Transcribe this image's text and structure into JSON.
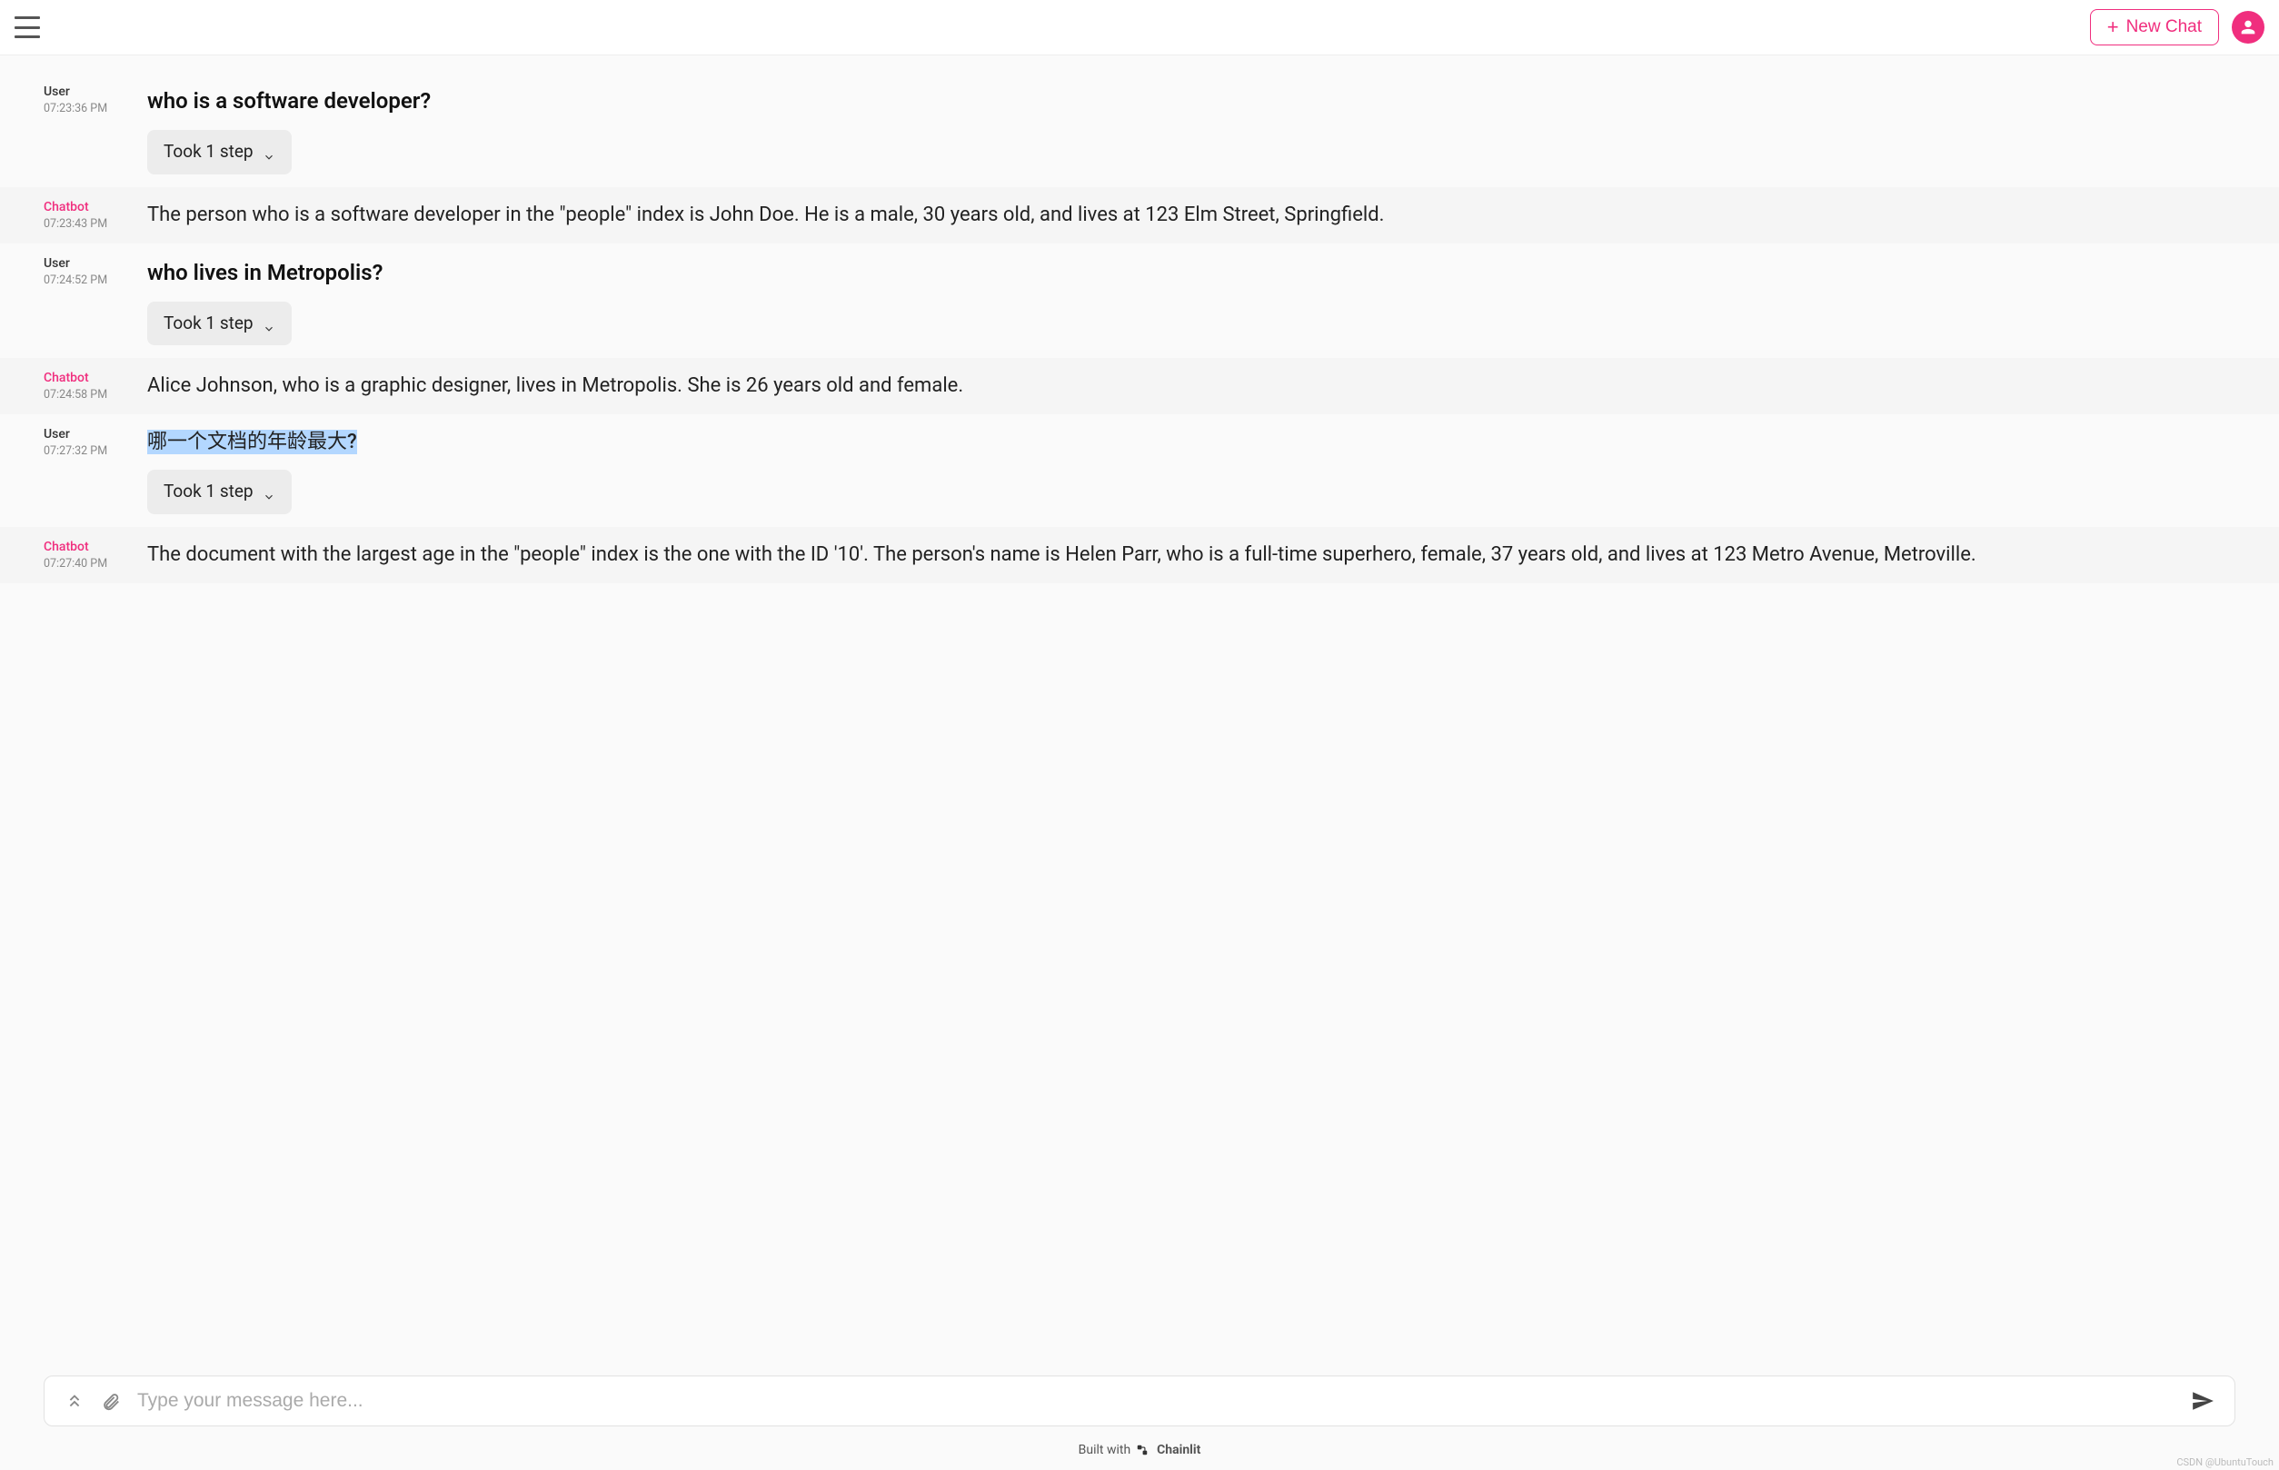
{
  "header": {
    "new_chat_label": "New Chat"
  },
  "messages": [
    {
      "author": "User",
      "author_class": "user",
      "time": "07:23:36 PM",
      "text": "who is a software developer?",
      "is_question": true,
      "highlighted": false,
      "step_label": "Took 1 step",
      "has_step": true,
      "bg": "plain"
    },
    {
      "author": "Chatbot",
      "author_class": "bot",
      "time": "07:23:43 PM",
      "text": "The person who is a software developer in the \"people\" index is John Doe. He is a male, 30 years old, and lives at 123 Elm Street, Springfield.",
      "is_question": false,
      "highlighted": false,
      "has_step": false,
      "bg": "bot"
    },
    {
      "author": "User",
      "author_class": "user",
      "time": "07:24:52 PM",
      "text": "who lives in Metropolis?",
      "is_question": true,
      "highlighted": false,
      "step_label": "Took 1 step",
      "has_step": true,
      "bg": "plain"
    },
    {
      "author": "Chatbot",
      "author_class": "bot",
      "time": "07:24:58 PM",
      "text": "Alice Johnson, who is a graphic designer, lives in Metropolis. She is 26 years old and female.",
      "is_question": false,
      "highlighted": false,
      "has_step": false,
      "bg": "bot"
    },
    {
      "author": "User",
      "author_class": "user",
      "time": "07:27:32 PM",
      "text": "哪一个文档的年龄最大?",
      "is_question": false,
      "highlighted": true,
      "step_label": "Took 1 step",
      "has_step": true,
      "bg": "plain"
    },
    {
      "author": "Chatbot",
      "author_class": "bot",
      "time": "07:27:40 PM",
      "text": "The document with the largest age in the \"people\" index is the one with the ID '10'. The person's name is Helen Parr, who is a full-time superhero, female, 37 years old, and lives at 123 Metro Avenue, Metroville.",
      "is_question": false,
      "highlighted": false,
      "has_step": false,
      "bg": "bot"
    }
  ],
  "composer": {
    "placeholder": "Type your message here..."
  },
  "footer": {
    "prefix": "Built with",
    "brand": "Chainlit"
  },
  "watermark": "CSDN @UbuntuTouch"
}
